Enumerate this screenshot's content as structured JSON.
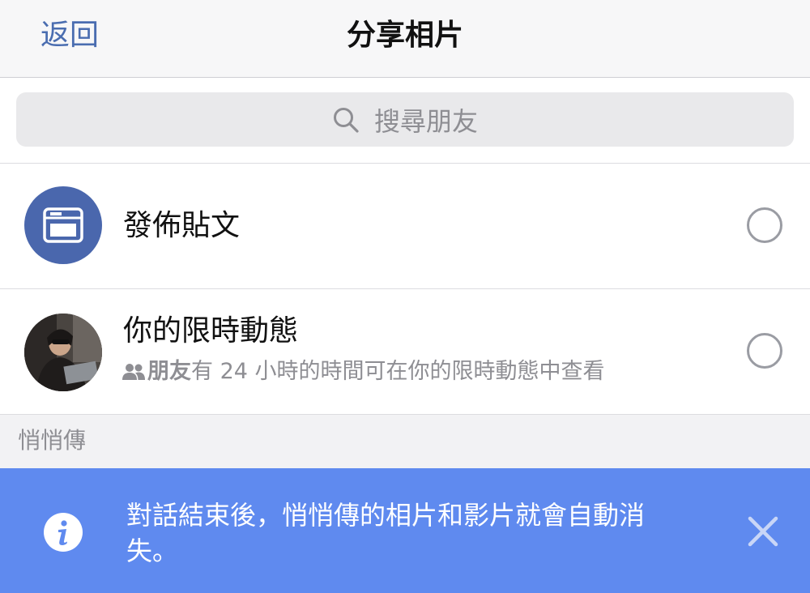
{
  "header": {
    "back_label": "返回",
    "title": "分享相片"
  },
  "search": {
    "placeholder": "搜尋朋友",
    "icon": "search-icon"
  },
  "options": [
    {
      "title": "發佈貼文",
      "icon": "post-icon"
    },
    {
      "title": "你的限時動態",
      "subtitle_bold": "朋友",
      "subtitle_rest": "有 24 小時的時間可在你的限時動態中查看",
      "icon": "friends-icon"
    }
  ],
  "section": {
    "label": "悄悄傳"
  },
  "banner": {
    "text": "對話結束後，悄悄傳的相片和影片就會自動消失。",
    "icon": "info-icon",
    "close_icon": "close-icon"
  },
  "colors": {
    "accent": "#4a6db0",
    "post_icon_bg": "#4a67ad",
    "banner_bg": "#5f8aef"
  }
}
